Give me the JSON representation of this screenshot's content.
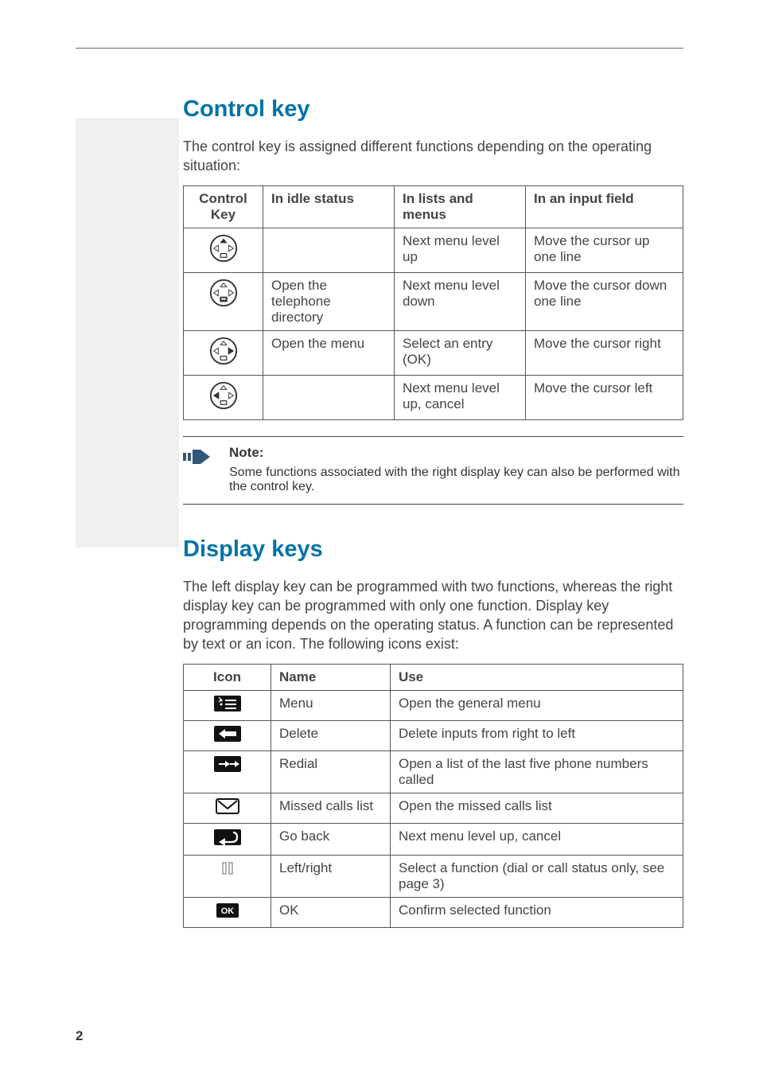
{
  "section1": {
    "heading": "Control key",
    "intro": "The control key is assigned different functions depending on the operating situation:",
    "table": {
      "headers": [
        "Control Key",
        "In idle status",
        "In lists and menus",
        "In an input field"
      ],
      "rows": [
        {
          "idle": "",
          "lists": "Next menu level up",
          "input": "Move the cursor up one line"
        },
        {
          "idle": "Open the telephone directory",
          "lists": "Next menu level down",
          "input": "Move the cursor down one line"
        },
        {
          "idle": "Open the menu",
          "lists": "Select an entry (OK)",
          "input": "Move the cursor right"
        },
        {
          "idle": "",
          "lists": "Next menu level up, cancel",
          "input": "Move the cursor left"
        }
      ]
    }
  },
  "note": {
    "label": "Note:",
    "body": "Some functions associated with the right display key can also be performed with the control key."
  },
  "section2": {
    "heading": "Display keys",
    "intro": "The left display key can be programmed with two functions, whereas the right display key can be programmed with only one function. Display key programming depends on the operating status. A function can be represented by text or an icon. The following icons exist:",
    "table": {
      "headers": [
        "Icon",
        "Name",
        "Use"
      ],
      "rows": [
        {
          "name": "Menu",
          "use": "Open the general menu"
        },
        {
          "name": "Delete",
          "use": "Delete inputs from right to left"
        },
        {
          "name": "Redial",
          "use": "Open a list of the last five phone numbers called"
        },
        {
          "name": "Missed calls list",
          "use": "Open the missed calls list"
        },
        {
          "name": "Go back",
          "use": "Next menu level up, cancel"
        },
        {
          "name": "Left/right",
          "use": "Select a function (dial or call status only, see page 3)"
        },
        {
          "name": "OK",
          "use": "Confirm selected function"
        }
      ]
    }
  },
  "pageNumber": "2"
}
